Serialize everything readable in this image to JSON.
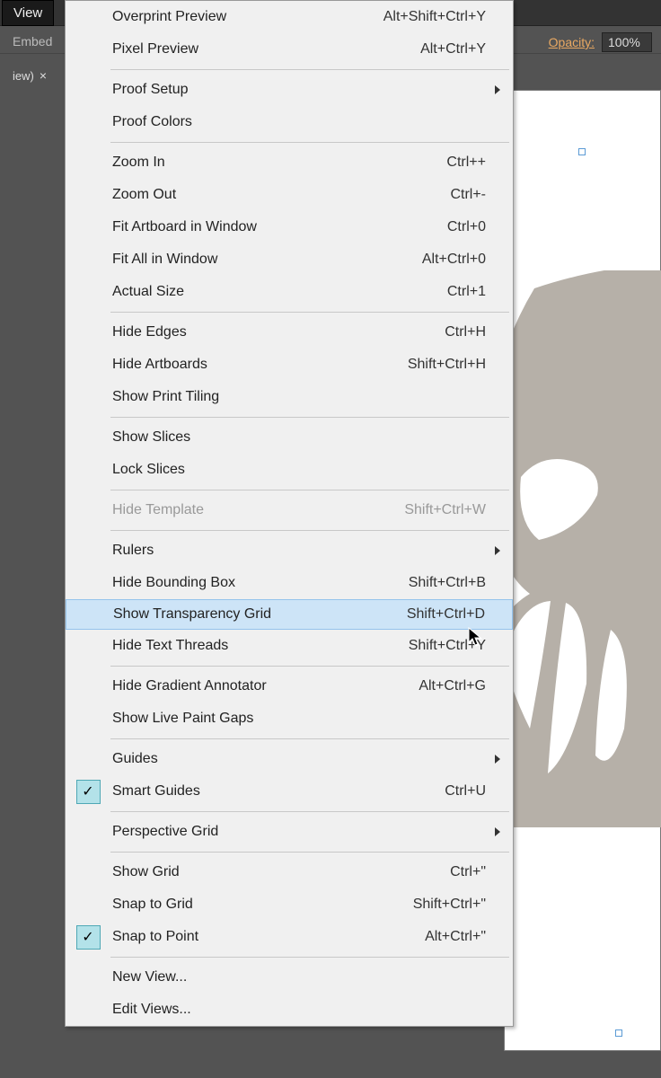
{
  "menubar": {
    "view_label": "View"
  },
  "toolbar": {
    "embed_label": "Embed",
    "tab_suffix": "iew)",
    "opacity": {
      "label": "Opacity:",
      "value": "100%"
    }
  },
  "menu": {
    "sections": [
      [
        {
          "id": "overprint-preview",
          "label": "Overprint Preview",
          "shortcut": "Alt+Shift+Ctrl+Y"
        },
        {
          "id": "pixel-preview",
          "label": "Pixel Preview",
          "shortcut": "Alt+Ctrl+Y"
        }
      ],
      [
        {
          "id": "proof-setup",
          "label": "Proof Setup",
          "submenu": true
        },
        {
          "id": "proof-colors",
          "label": "Proof Colors"
        }
      ],
      [
        {
          "id": "zoom-in",
          "label": "Zoom In",
          "shortcut": "Ctrl++"
        },
        {
          "id": "zoom-out",
          "label": "Zoom Out",
          "shortcut": "Ctrl+-"
        },
        {
          "id": "fit-artboard",
          "label": "Fit Artboard in Window",
          "shortcut": "Ctrl+0"
        },
        {
          "id": "fit-all",
          "label": "Fit All in Window",
          "shortcut": "Alt+Ctrl+0"
        },
        {
          "id": "actual-size",
          "label": "Actual Size",
          "shortcut": "Ctrl+1"
        }
      ],
      [
        {
          "id": "hide-edges",
          "label": "Hide Edges",
          "shortcut": "Ctrl+H"
        },
        {
          "id": "hide-artboards",
          "label": "Hide Artboards",
          "shortcut": "Shift+Ctrl+H"
        },
        {
          "id": "show-print-tiling",
          "label": "Show Print Tiling"
        }
      ],
      [
        {
          "id": "show-slices",
          "label": "Show Slices"
        },
        {
          "id": "lock-slices",
          "label": "Lock Slices"
        }
      ],
      [
        {
          "id": "hide-template",
          "label": "Hide Template",
          "shortcut": "Shift+Ctrl+W",
          "disabled": true
        }
      ],
      [
        {
          "id": "rulers",
          "label": "Rulers",
          "submenu": true
        },
        {
          "id": "hide-bounding-box",
          "label": "Hide Bounding Box",
          "shortcut": "Shift+Ctrl+B"
        },
        {
          "id": "show-transparency-grid",
          "label": "Show Transparency Grid",
          "shortcut": "Shift+Ctrl+D",
          "highlighted": true
        },
        {
          "id": "hide-text-threads",
          "label": "Hide Text Threads",
          "shortcut": "Shift+Ctrl+Y"
        }
      ],
      [
        {
          "id": "hide-gradient-annotator",
          "label": "Hide Gradient Annotator",
          "shortcut": "Alt+Ctrl+G"
        },
        {
          "id": "show-live-paint-gaps",
          "label": "Show Live Paint Gaps"
        }
      ],
      [
        {
          "id": "guides",
          "label": "Guides",
          "submenu": true
        },
        {
          "id": "smart-guides",
          "label": "Smart Guides",
          "shortcut": "Ctrl+U",
          "checked": true
        }
      ],
      [
        {
          "id": "perspective-grid",
          "label": "Perspective Grid",
          "submenu": true
        }
      ],
      [
        {
          "id": "show-grid",
          "label": "Show Grid",
          "shortcut": "Ctrl+\""
        },
        {
          "id": "snap-to-grid",
          "label": "Snap to Grid",
          "shortcut": "Shift+Ctrl+\""
        },
        {
          "id": "snap-to-point",
          "label": "Snap to Point",
          "shortcut": "Alt+Ctrl+\"",
          "checked": true
        }
      ],
      [
        {
          "id": "new-view",
          "label": "New View..."
        },
        {
          "id": "edit-views",
          "label": "Edit Views..."
        }
      ]
    ]
  }
}
